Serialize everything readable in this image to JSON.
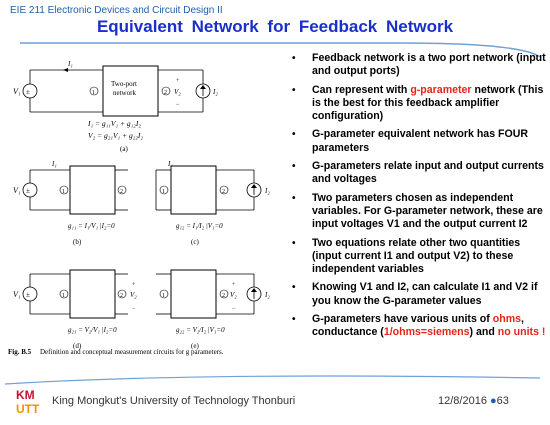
{
  "header": {
    "course": "EIE 211 Electronic Devices and Circuit Design II",
    "title": "Equivalent  Network  for  Feedback  Network"
  },
  "figure": {
    "two_port_label_1": "Two-port",
    "two_port_label_2": "network",
    "eq1": "I₁ = g₁₁V₁ + g₁₂I₂",
    "eq2": "V₂ = g₂₁V₁ + g₂₂I₂",
    "label_a": "(a)",
    "label_b": "(b)",
    "label_c": "(c)",
    "label_d": "(d)",
    "label_e": "(e)",
    "g11": "g₁₁ = I₁/V₁ |I₂=0",
    "g12": "g₁₂ = I₁/I₂ |V₁=0",
    "g21": "g₂₁ = V₂/V₁ |I₂=0",
    "g22": "g₂₂ = V₂/I₂ |V₁=0",
    "caption_bold": "Fig. B.5",
    "caption": "Definition and conceptual measurement circuits for g parameters."
  },
  "bullets": [
    {
      "text": "Feedback network is a two port network (input and output ports)"
    },
    {
      "pre": "Can represent with ",
      "red": "g-parameter",
      "post": " network (This is the best for this feedback amplifier configuration)"
    },
    {
      "text": "G-parameter equivalent network has FOUR parameters"
    },
    {
      "text": "G-parameters relate input and output currents and voltages"
    },
    {
      "text": "Two parameters chosen as independent variables.  For G-parameter network, these are input voltages V1  and the output current I2"
    },
    {
      "text": "Two equations relate other two quantities (input current I1 and output V2) to these independent variables"
    },
    {
      "text": "Knowing V1 and I2, can calculate I1 and V2 if you know the G-parameter values"
    },
    {
      "pre": "G-parameters have various units of ",
      "red": "ohms",
      "post": ", conductance (",
      "red2": "1/ohms=siemens",
      "post2": ") and ",
      "red3": "no units !",
      "post3": ""
    }
  ],
  "footer": {
    "university": "King Mongkut's University of Technology Thonburi",
    "date": "12/8/2016",
    "page": "63",
    "logo_text": "KMUTT"
  },
  "colors": {
    "title": "#1a2fc9",
    "course": "#1f5fa8",
    "highlight": "#e8231a",
    "line": "#6fa0d8"
  }
}
